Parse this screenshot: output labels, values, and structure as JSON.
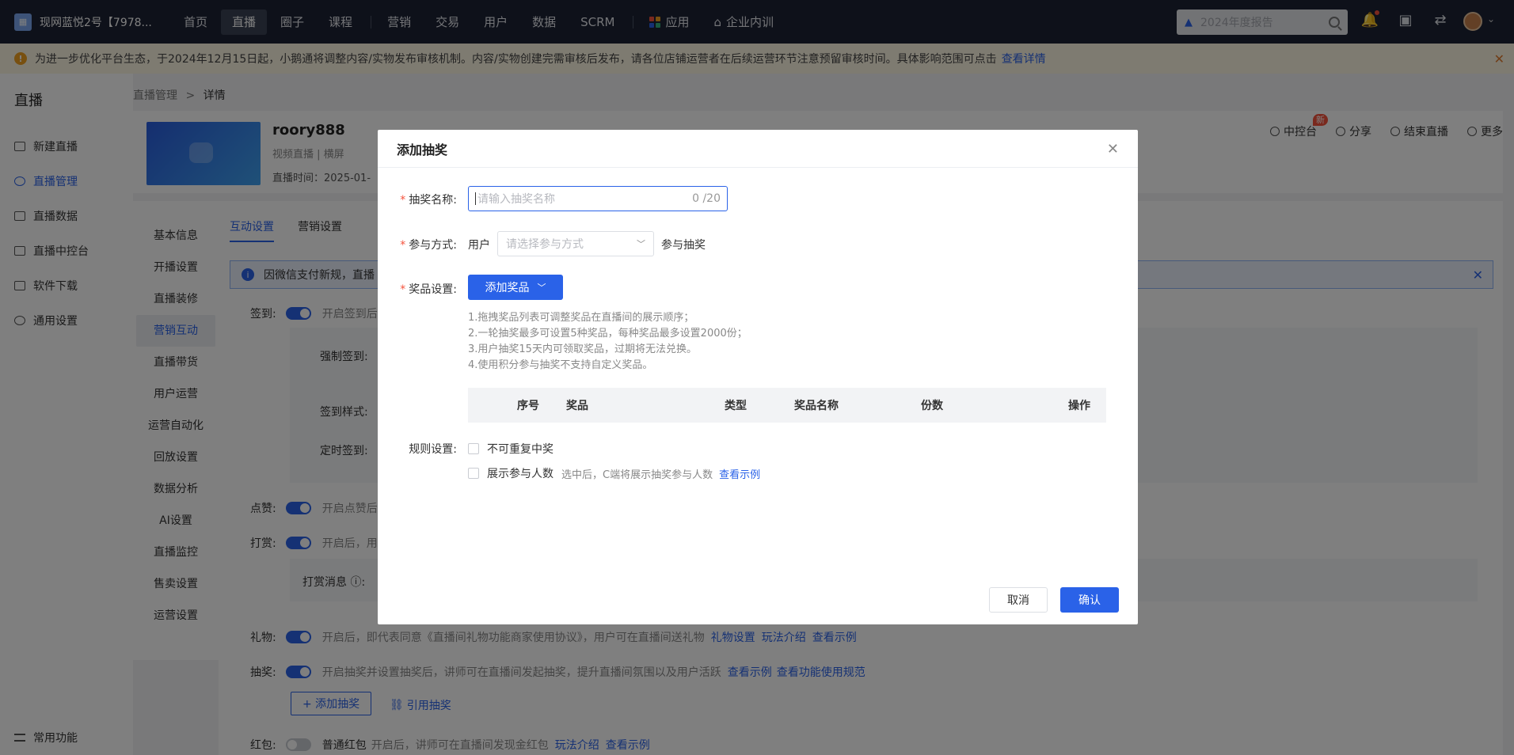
{
  "topnav": {
    "brand": "现网蓝悦2号【7978...",
    "items": [
      "首页",
      "直播",
      "圈子",
      "课程",
      "营销",
      "交易",
      "用户",
      "数据",
      "SCRM",
      "应用",
      "企业内训"
    ],
    "search_placeholder": "2024年度报告"
  },
  "notice": {
    "text": "为进一步优化平台生态，于2024年12月15日起，小鹅通将调整内容/实物发布审核机制。内容/实物创建完需审核后发布，请各位店铺运营者在后续运营环节注意预留审核时间。具体影响范围可点击",
    "link": "查看详情"
  },
  "sidebar": {
    "title": "直播",
    "items": [
      "新建直播",
      "直播管理",
      "直播数据",
      "直播中控台",
      "软件下载",
      "通用设置"
    ],
    "bottom": "常用功能"
  },
  "breadcrumb": {
    "parent": "直播管理",
    "sep": ">",
    "current": "详情"
  },
  "live": {
    "name": "roory888",
    "meta": "视频直播  |  横屏",
    "time": "直播时间：2025-01-",
    "actions": [
      "中控台",
      "分享",
      "结束直播",
      "更多"
    ],
    "new_badge": "新"
  },
  "subnav": [
    "基本信息",
    "开播设置",
    "直播装修",
    "营销互动",
    "直播带货",
    "用户运营",
    "运营自动化",
    "回放设置",
    "数据分析",
    "AI设置",
    "直播监控",
    "售卖设置",
    "运营设置"
  ],
  "main": {
    "tabs": [
      "互动设置",
      "营销设置"
    ],
    "info": "因微信支付新规，直播",
    "signin_label": "签到:",
    "signin_desc": "开启签到后",
    "force_label": "强制签到:",
    "style_label": "签到样式:",
    "timer_label": "定时签到:",
    "like_label": "点赞:",
    "like_desc": "开启点赞后",
    "tip_label": "打赏:",
    "tip_desc": "开启后，用",
    "tipmsg_label": "打赏消息 ⓘ:",
    "gift_label": "礼物:",
    "gift_desc": "开启后，即代表同意《直播间礼物功能商家使用协议》，用户可在直播间送礼物",
    "gift_links": [
      "礼物设置",
      "玩法介绍",
      "查看示例"
    ],
    "lottery_label": "抽奖:",
    "lottery_desc": "开启抽奖并设置抽奖后，讲师可在直播间发起抽奖，提升直播间氛围以及用户活跃",
    "lottery_links": [
      "查看示例",
      "查看功能使用规范"
    ],
    "add_lottery": "+ 添加抽奖",
    "ref_lottery": "引用抽奖",
    "redpack_label": "红包:",
    "redpack_name": "普通红包",
    "redpack_desc": "开启后，讲师可在直播间发现金红包",
    "redpack_links": [
      "玩法介绍",
      "查看示例"
    ]
  },
  "modal": {
    "title": "添加抽奖",
    "name_label": "抽奖名称:",
    "name_placeholder": "请输入抽奖名称",
    "name_count": "0 /20",
    "join_label": "参与方式:",
    "join_prefix": "用户",
    "join_placeholder": "请选择参与方式",
    "join_suffix": "参与抽奖",
    "prize_label": "奖品设置:",
    "prize_button": "添加奖品",
    "tips": [
      "1.拖拽奖品列表可调整奖品在直播间的展示顺序；",
      "2.一轮抽奖最多可设置5种奖品，每种奖品最多设置2000份；",
      "3.用户抽奖15天内可领取奖品，过期将无法兑换。",
      "4.使用积分参与抽奖不支持自定义奖品。"
    ],
    "table_headers": [
      "序号",
      "奖品",
      "类型",
      "奖品名称",
      "份数",
      "操作"
    ],
    "rules_label": "规则设置:",
    "rule1": "不可重复中奖",
    "rule2": "展示参与人数",
    "rule2_desc": "选中后，C端将展示抽奖参与人数",
    "rule2_link": "查看示例",
    "cancel": "取消",
    "confirm": "确认"
  }
}
